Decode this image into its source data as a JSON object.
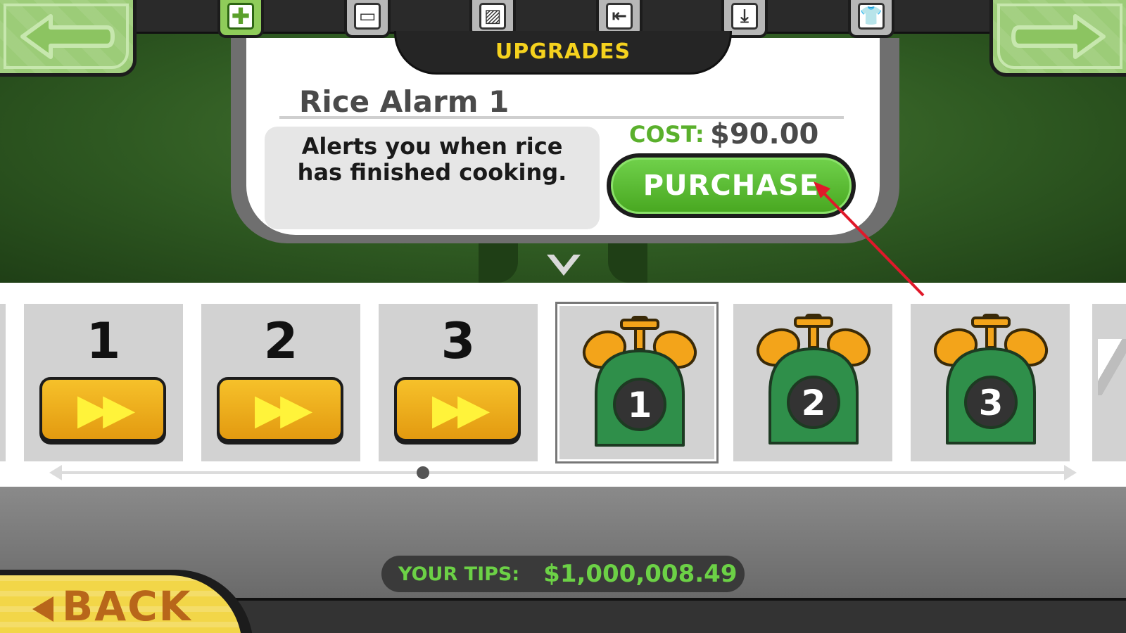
{
  "nav": {
    "left_icon": "arrow-left-icon",
    "right_icon": "arrow-right-icon"
  },
  "tabs": [
    {
      "id": "first-aid",
      "icon": "plus-icon",
      "glyph": "✚",
      "active": true
    },
    {
      "id": "tables",
      "icon": "table-icon",
      "glyph": "▭",
      "active": false
    },
    {
      "id": "decor",
      "icon": "picture-icon",
      "glyph": "▨",
      "active": false
    },
    {
      "id": "wall",
      "icon": "exit-door-icon",
      "glyph": "⇤",
      "active": false
    },
    {
      "id": "floor",
      "icon": "download-icon",
      "glyph": "⤓",
      "active": false
    },
    {
      "id": "clothing",
      "icon": "shirt-icon",
      "glyph": "👕",
      "active": false
    }
  ],
  "header": {
    "title": "UPGRADES"
  },
  "detail": {
    "title": "Rice Alarm 1",
    "description": "Alerts you when rice has finished cooking.",
    "cost_label": "COST:",
    "cost_value": "$90.00",
    "purchase_label": "PURCHASE"
  },
  "items": [
    {
      "kind": "speed",
      "number": "1",
      "icon": "fast-forward-icon",
      "glyph": "▶▶"
    },
    {
      "kind": "speed",
      "number": "2",
      "icon": "fast-forward-icon",
      "glyph": "▶▶"
    },
    {
      "kind": "speed",
      "number": "3",
      "icon": "fast-forward-icon",
      "glyph": "▶▶"
    },
    {
      "kind": "alarm",
      "number": "1",
      "icon": "alarm-clock-icon",
      "selected": true
    },
    {
      "kind": "alarm",
      "number": "2",
      "icon": "alarm-clock-icon",
      "selected": false
    },
    {
      "kind": "alarm",
      "number": "3",
      "icon": "alarm-clock-icon",
      "selected": false
    }
  ],
  "footer": {
    "tips_label": "YOUR TIPS:",
    "tips_value": "$1,000,008.49",
    "back_label": "BACK",
    "back_icon": "triangle-left-icon"
  },
  "colors": {
    "accent_green": "#5ab02c",
    "tips_green": "#6cd146",
    "header_yellow": "#f5d21e",
    "annotation_red": "#e0192a"
  }
}
